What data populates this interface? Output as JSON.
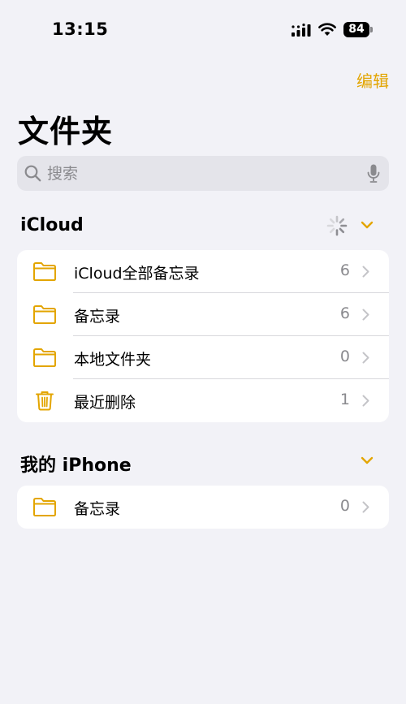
{
  "status_bar": {
    "time": "13:15",
    "battery_level": "84"
  },
  "nav": {
    "edit_label": "编辑",
    "title": "文件夹"
  },
  "search": {
    "placeholder": "搜索"
  },
  "sections": [
    {
      "title": "iCloud",
      "syncing": true,
      "items": [
        {
          "icon": "folder-icon",
          "label": "iCloud全部备忘录",
          "count": "6"
        },
        {
          "icon": "folder-icon",
          "label": "备忘录",
          "count": "6"
        },
        {
          "icon": "folder-icon",
          "label": "本地文件夹",
          "count": "0"
        },
        {
          "icon": "trash-icon",
          "label": "最近删除",
          "count": "1"
        }
      ]
    },
    {
      "title": "我的 iPhone",
      "syncing": false,
      "items": [
        {
          "icon": "folder-icon",
          "label": "备忘录",
          "count": "0"
        }
      ]
    }
  ],
  "colors": {
    "accent": "#e3a500",
    "background": "#f2f2f7",
    "secondary_text": "#8a8a8e"
  }
}
